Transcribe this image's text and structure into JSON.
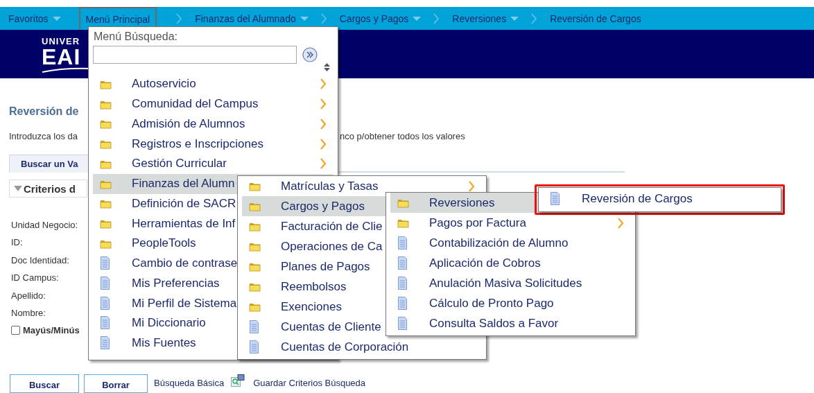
{
  "nav": [
    {
      "label": "Favoritos",
      "kind": "menu",
      "dropdown": true,
      "selected": false
    },
    {
      "label": "Menú Principal",
      "kind": "menu",
      "dropdown": false,
      "selected": true
    },
    {
      "label": "Finanzas del Alumnado",
      "kind": "crumb",
      "dropdown": true,
      "selected": false
    },
    {
      "label": "Cargos y Pagos",
      "kind": "crumb",
      "dropdown": true,
      "selected": false
    },
    {
      "label": "Reversiones",
      "kind": "crumb",
      "dropdown": true,
      "selected": false
    },
    {
      "label": "Reversión de Cargos",
      "kind": "crumb",
      "dropdown": false,
      "selected": false
    }
  ],
  "banner": {
    "logo_lines": [
      "UNIVER",
      "EAI"
    ]
  },
  "page": {
    "title": "Reversión de",
    "instructions": [
      "Introduzca los da",
      "nco p/obtener todos los valores"
    ],
    "tab": "Buscar un Va",
    "section": {
      "label": "Criterios d",
      "expanded": true
    },
    "fields": [
      "Unidad Negocio:",
      "ID:",
      "Doc Identidad:",
      "ID Campus:",
      "Apellido:",
      "Nombre:"
    ],
    "checkbox": {
      "label": "Mayús/Minús",
      "checked": false
    },
    "buttons": [
      "Buscar",
      "Borrar"
    ],
    "links": [
      {
        "label": "Búsqueda Básica",
        "icon": false
      },
      {
        "label": "Guardar Criterios Búsqueda",
        "icon": true
      }
    ]
  },
  "menus": [
    {
      "search_label": "Menú Búsqueda:",
      "items": [
        {
          "label": "Autoservicio",
          "kind": "folder",
          "submenu": true,
          "selected": false
        },
        {
          "label": "Comunidad del Campus",
          "kind": "folder",
          "submenu": true,
          "selected": false
        },
        {
          "label": "Admisión de Alumnos",
          "kind": "folder",
          "submenu": true,
          "selected": false
        },
        {
          "label": "Registros e Inscripciones",
          "kind": "folder",
          "submenu": true,
          "selected": false
        },
        {
          "label": "Gestión Curricular",
          "kind": "folder",
          "submenu": true,
          "selected": false
        },
        {
          "label": "Finanzas del Alumn",
          "kind": "folder",
          "submenu": false,
          "selected": true
        },
        {
          "label": "Definición de SACR",
          "kind": "folder",
          "submenu": false,
          "selected": false
        },
        {
          "label": "Herramientas de Inf",
          "kind": "folder",
          "submenu": false,
          "selected": false
        },
        {
          "label": "PeopleTools",
          "kind": "folder",
          "submenu": false,
          "selected": false
        },
        {
          "label": "Cambio de contrase",
          "kind": "page",
          "submenu": false,
          "selected": false
        },
        {
          "label": "Mis Preferencias",
          "kind": "page",
          "submenu": false,
          "selected": false
        },
        {
          "label": "Mi Perfil de Sistema",
          "kind": "page",
          "submenu": false,
          "selected": false
        },
        {
          "label": "Mi Diccionario",
          "kind": "page",
          "submenu": false,
          "selected": false
        },
        {
          "label": "Mis Fuentes",
          "kind": "page",
          "submenu": false,
          "selected": false
        }
      ]
    },
    {
      "items": [
        {
          "label": "Matrículas y Tasas",
          "kind": "folder",
          "submenu": true,
          "selected": false
        },
        {
          "label": "Cargos y Pagos",
          "kind": "folder",
          "submenu": false,
          "selected": true
        },
        {
          "label": "Facturación de Clie",
          "kind": "folder",
          "submenu": false,
          "selected": false
        },
        {
          "label": "Operaciones de Ca",
          "kind": "folder",
          "submenu": false,
          "selected": false
        },
        {
          "label": "Planes de Pagos",
          "kind": "folder",
          "submenu": false,
          "selected": false
        },
        {
          "label": "Reembolsos",
          "kind": "folder",
          "submenu": false,
          "selected": false
        },
        {
          "label": "Exenciones",
          "kind": "folder",
          "submenu": false,
          "selected": false
        },
        {
          "label": "Cuentas de Cliente",
          "kind": "page",
          "submenu": false,
          "selected": false
        },
        {
          "label": "Cuentas de Corporación",
          "kind": "page",
          "submenu": false,
          "selected": false
        }
      ]
    },
    {
      "items": [
        {
          "label": "Reversiones",
          "kind": "folder",
          "submenu": false,
          "selected": true
        },
        {
          "label": "Pagos por Factura",
          "kind": "folder",
          "submenu": true,
          "selected": false
        },
        {
          "label": "Contabilización de Alumno",
          "kind": "page",
          "submenu": false,
          "selected": false
        },
        {
          "label": "Aplicación de Cobros",
          "kind": "page",
          "submenu": false,
          "selected": false
        },
        {
          "label": "Anulación Masiva Solicitudes",
          "kind": "page",
          "submenu": false,
          "selected": false
        },
        {
          "label": "Cálculo de Pronto Pago",
          "kind": "page",
          "submenu": false,
          "selected": false
        },
        {
          "label": "Consulta Saldos a Favor",
          "kind": "page",
          "submenu": false,
          "selected": false
        }
      ]
    },
    {
      "highlighted": true,
      "items": [
        {
          "label": "Reversión de Cargos",
          "kind": "page",
          "submenu": false,
          "selected": false
        }
      ]
    }
  ]
}
